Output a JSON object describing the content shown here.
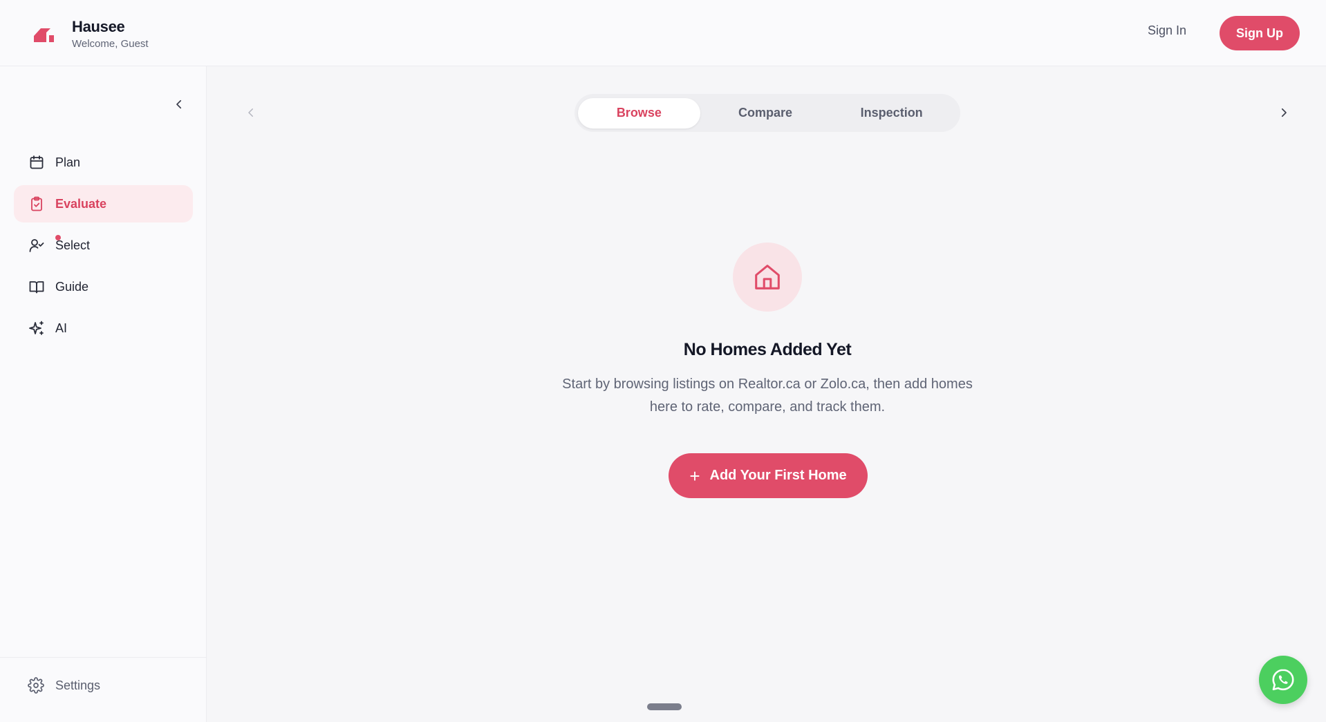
{
  "brand": {
    "name": "Hausee",
    "subtitle": "Welcome, Guest"
  },
  "header": {
    "sign_in": "Sign In",
    "sign_up": "Sign Up"
  },
  "sidebar": {
    "items": [
      {
        "label": "Plan",
        "icon": "calendar-icon"
      },
      {
        "label": "Evaluate",
        "icon": "clipboard-check-icon",
        "active": true
      },
      {
        "label": "Select",
        "icon": "user-check-icon",
        "notification": true
      },
      {
        "label": "Guide",
        "icon": "book-open-icon"
      },
      {
        "label": "AI",
        "icon": "sparkles-icon"
      }
    ],
    "settings": "Settings"
  },
  "tabs": [
    {
      "label": "Browse",
      "active": true
    },
    {
      "label": "Compare"
    },
    {
      "label": "Inspection"
    }
  ],
  "empty_state": {
    "title": "No Homes Added Yet",
    "description": "Start by browsing listings on Realtor.ca or Zolo.ca, then add homes here to rate, compare, and track them.",
    "button": "Add Your First Home",
    "button_icon": "+"
  },
  "colors": {
    "accent": "#e04c69",
    "accent_soft": "#fcebee",
    "whatsapp": "#4ccf5f"
  }
}
